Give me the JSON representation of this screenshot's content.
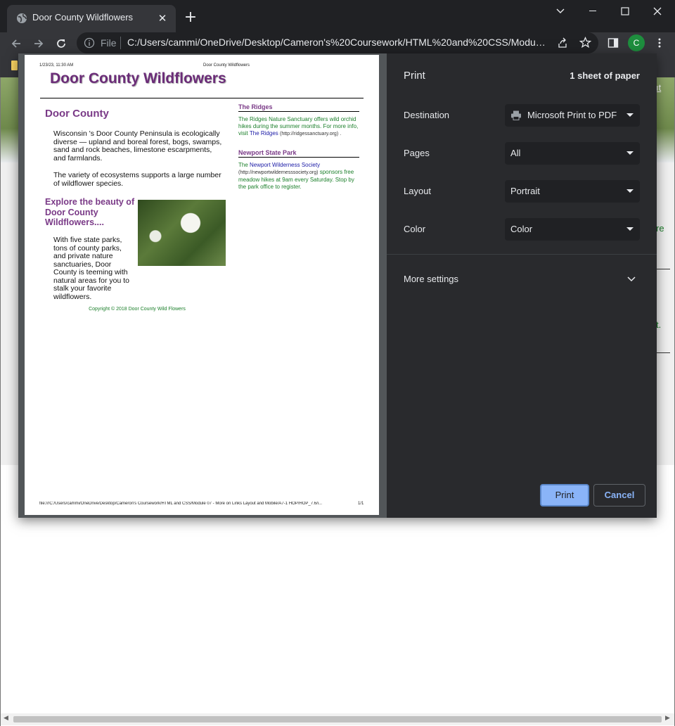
{
  "browser": {
    "tab_title": "Door County Wildflowers",
    "tab_close": "✕",
    "new_tab": "+",
    "omnibox_scheme": "File",
    "url": "C:/Users/cammi/OneDrive/Desktop/Cameron's%20Coursework/HTML%20and%20CSS/Module...",
    "profile_initial": "C"
  },
  "print_preview": {
    "header_date": "1/23/23, 11:30 AM",
    "header_title": "Door County Wildflowers",
    "page_title": "Door County Wildflowers",
    "heading": "Door County",
    "para1": "Wisconsin 's Door County Peninsula is ecologically diverse — upland and boreal forest, bogs, swamps, sand and rock beaches, limestone escarpments, and farmlands.",
    "para2": "The variety of ecosystems supports a large number of wildflower species.",
    "subheading": "Explore the beauty of Door County Wildflowers....",
    "para3": "With five state parks, tons of county parks, and private nature sanctuaries, Door County is teeming with natural areas for you to stalk your favorite wildflowers.",
    "copyright": "Copyright © 2018 Door County Wild Flowers",
    "ridges": {
      "heading": "The Ridges",
      "text": "The Ridges Nature Sanctuary offers wild orchid hikes during the summer months. For more info, visit",
      "link": "The Ridges",
      "url": "(http://ridgessanctuary.org)",
      "end": "."
    },
    "newport": {
      "heading": "Newport State Park",
      "pre": "The",
      "link": "Newport Wilderness Society",
      "url": "(http://newportwildernesssociety.org)",
      "text": "sponsors free meadow hikes at 9am every Saturday. Stop by the park office to register."
    },
    "footer_path": "file:///C:/Users/cammi/OneDrive/Desktop/Cameron's Coursework/HTML and CSS/Module 07 - More on Links Layout and Mobile/A7-1 HOP/HOP_7.6/i...",
    "page_number": "1/1"
  },
  "print_settings": {
    "title": "Print",
    "sheets": "1 sheet of paper",
    "destination_label": "Destination",
    "destination_value": "Microsoft Print to PDF",
    "pages_label": "Pages",
    "pages_value": "All",
    "layout_label": "Layout",
    "layout_value": "Portrait",
    "color_label": "Color",
    "color_value": "Color",
    "more_settings": "More settings",
    "print_button": "Print",
    "cancel_button": "Cancel"
  },
  "background_page": {
    "link_fragment": "ıt",
    "text_fragment_1": "re",
    "text_fragment_2": "t."
  }
}
